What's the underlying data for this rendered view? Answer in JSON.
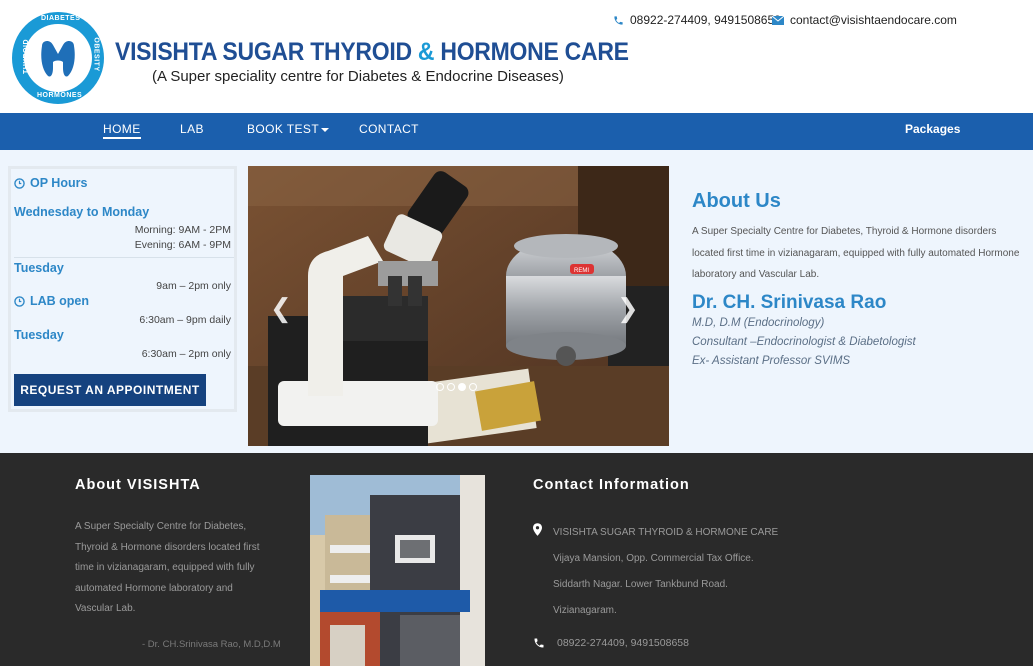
{
  "header": {
    "logo": {
      "ring_top": "DIABETES",
      "ring_bottom": "HORMONES",
      "ring_left": "THYROID",
      "ring_right": "OBESITY",
      "color": "#1a9ad6"
    },
    "title_part1": "VISISHTA SUGAR THYROID ",
    "title_amp": "&",
    "title_part2": " HORMONE CARE",
    "subtitle": "(A Super speciality centre for Diabetes & Endocrine Diseases)",
    "phone": "08922-274409, 9491508658",
    "email": "contact@visishtaendocare.com"
  },
  "nav": {
    "home": "HOME",
    "lab": "LAB",
    "book_test": "BOOK TEST",
    "contact": "CONTACT",
    "packages": "Packages",
    "color": "#1b5fad"
  },
  "sidebar": {
    "op_hours": "OP Hours",
    "wed_mon": "Wednesday to Monday",
    "morning": "Morning: 9AM - 2PM",
    "evening": "Evening: 6AM - 9PM",
    "tuesday1": "Tuesday",
    "tuesday1_time": "9am – 2pm only",
    "lab_open": "LAB open",
    "lab_time": "6:30am – 9pm daily",
    "tuesday2": "Tuesday",
    "tuesday2_time": "6:30am – 2pm only",
    "appointment_button": "REQUEST AN APPOINTMENT"
  },
  "slider": {
    "prev_icon": "chevron-left-icon",
    "next_icon": "chevron-right-icon",
    "slide_count": 4,
    "active_slide": 3,
    "image_label": "REMI"
  },
  "about": {
    "title": "About Us",
    "text": "A Super Specialty Centre for Diabetes, Thyroid & Hormone disorders located first time in vizianagaram, equipped with fully automated Hormone laboratory and Vascular Lab.",
    "doctor_name": "Dr. CH. Srinivasa Rao",
    "doctor_degree": "M.D, D.M (Endocrinology)",
    "doctor_role": "Consultant –Endocrinologist & Diabetologist",
    "doctor_prev": "Ex- Assistant Professor SVIMS"
  },
  "footer": {
    "about_title": "About VISISHTA",
    "about_text": "A Super Specialty Centre for Diabetes, Thyroid & Hormone disorders located first time in vizianagaram, equipped with fully automated Hormone laboratory and Vascular Lab.",
    "signature": "- Dr. CH.Srinivasa Rao, M.D,D.M",
    "contact_title": "Contact Information",
    "address": [
      "VISISHTA SUGAR THYROID & HORMONE CARE",
      "Vijaya Mansion, Opp. Commercial Tax Office.",
      "Siddarth Nagar. Lower Tankbund Road.",
      "Vizianagaram."
    ],
    "phone": "08922-274409, 9491508658"
  }
}
